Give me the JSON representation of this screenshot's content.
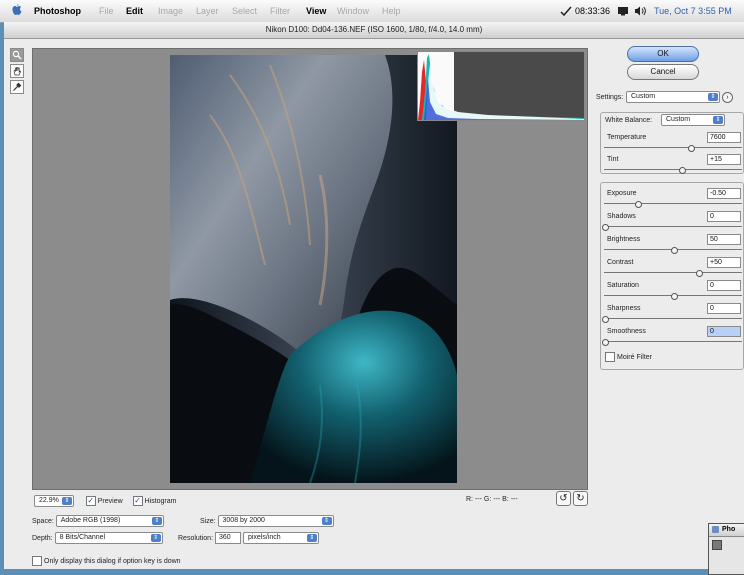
{
  "menubar": {
    "app": "Photoshop",
    "menus": [
      "File",
      "Edit",
      "Image",
      "Layer",
      "Select",
      "Filter",
      "View",
      "Window",
      "Help"
    ],
    "time": "08:33:36",
    "clock": "Tue, Oct 7  3:55 PM"
  },
  "dialog": {
    "title": "Nikon D100:  Dd04-136.NEF  (ISO 1600, 1/80, f/4.0, 14.0 mm)"
  },
  "preview_bar": {
    "zoom": "22.9%",
    "preview_label": "Preview",
    "histogram_label": "Histogram",
    "rgb_readout": "R: --- G: --- B: ---"
  },
  "workflow": {
    "space_label": "Space:",
    "space_value": "Adobe RGB (1998)",
    "size_label": "Size:",
    "size_value": "3008 by 2000",
    "depth_label": "Depth:",
    "depth_value": "8 Bits/Channel",
    "resolution_label": "Resolution:",
    "resolution_value": "360",
    "resolution_unit": "pixels/inch",
    "only_display_label": "Only display this dialog if option key is down"
  },
  "buttons": {
    "ok": "OK",
    "cancel": "Cancel"
  },
  "settings": {
    "label": "Settings:",
    "value": "Custom"
  },
  "white_balance": {
    "label": "White Balance:",
    "value": "Custom",
    "temperature_label": "Temperature",
    "temperature_value": "7600",
    "temperature_pos": 0.62,
    "tint_label": "Tint",
    "tint_value": "+15",
    "tint_pos": 0.56
  },
  "adjust": [
    {
      "label": "Exposure",
      "value": "-0.50",
      "pos": 0.24
    },
    {
      "label": "Shadows",
      "value": "0",
      "pos": 0.0
    },
    {
      "label": "Brightness",
      "value": "50",
      "pos": 0.5
    },
    {
      "label": "Contrast",
      "value": "+50",
      "pos": 0.68
    },
    {
      "label": "Saturation",
      "value": "0",
      "pos": 0.5
    },
    {
      "label": "Sharpness",
      "value": "0",
      "pos": 0.0
    },
    {
      "label": "Smoothness",
      "value": "0",
      "pos": 0.0
    }
  ],
  "moire_label": "Moiré Filter",
  "inset": {
    "title": "Pho"
  }
}
